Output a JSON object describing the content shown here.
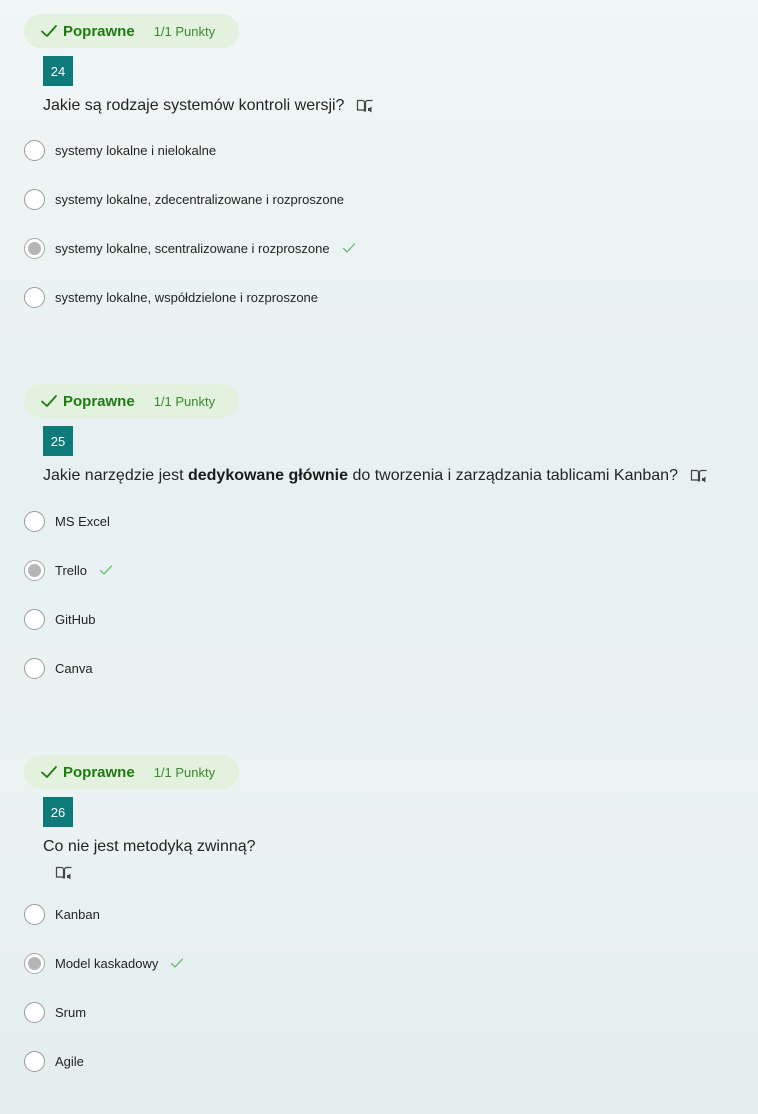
{
  "questions": [
    {
      "status": "Poprawne",
      "points": "1/1 Punkty",
      "number": "24",
      "text_parts": [
        "Jakie są rodzaje systemów kontroli wersji?"
      ],
      "options": [
        {
          "label": "systemy lokalne i nielokalne",
          "selected": false,
          "correct": false
        },
        {
          "label": "systemy lokalne, zdecentralizowane i rozproszone",
          "selected": false,
          "correct": false
        },
        {
          "label": "systemy lokalne, scentralizowane i rozproszone",
          "selected": true,
          "correct": true
        },
        {
          "label": "systemy lokalne, współdzielone i rozproszone",
          "selected": false,
          "correct": false
        }
      ]
    },
    {
      "status": "Poprawne",
      "points": "1/1 Punkty",
      "number": "25",
      "text_before": "Jakie narzędzie jest ",
      "text_bold": "dedykowane głównie",
      "text_after": " do tworzenia i zarządzania tablicami Kanban?",
      "options": [
        {
          "label": "MS Excel",
          "selected": false,
          "correct": false
        },
        {
          "label": "Trello",
          "selected": true,
          "correct": true
        },
        {
          "label": "GitHub",
          "selected": false,
          "correct": false
        },
        {
          "label": "Canva",
          "selected": false,
          "correct": false
        }
      ]
    },
    {
      "status": "Poprawne",
      "points": "1/1 Punkty",
      "number": "26",
      "text_parts": [
        "Co nie jest metodyką zwinną?"
      ],
      "options": [
        {
          "label": "Kanban",
          "selected": false,
          "correct": false
        },
        {
          "label": "Model kaskadowy",
          "selected": true,
          "correct": true
        },
        {
          "label": "Srum",
          "selected": false,
          "correct": false
        },
        {
          "label": "Agile",
          "selected": false,
          "correct": false
        }
      ]
    }
  ],
  "icons": {
    "badge_check": "checkmark-icon",
    "immersive_reader": "immersive-reader-icon",
    "correct_answer": "correct-check-icon"
  },
  "colors": {
    "badge_bg": "#e3f2de",
    "badge_text": "#1f7a12",
    "number_bg": "#0e7a7a",
    "correct_check": "#5cb85c"
  }
}
